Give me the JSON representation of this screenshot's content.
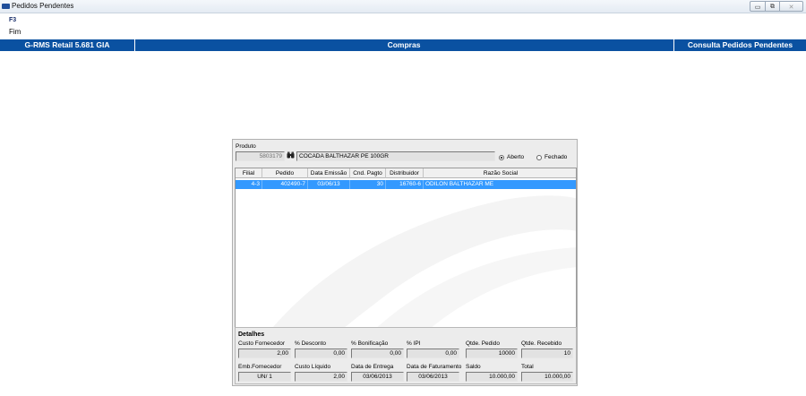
{
  "window": {
    "title": "Pedidos Pendentes",
    "buttons": [
      "▭",
      "⧉",
      "✕"
    ]
  },
  "toolbar": {
    "key": "F3",
    "label": "Fim"
  },
  "header": {
    "app": "G-RMS Retail 5.681 GIA",
    "module": "Compras",
    "screen": "Consulta Pedidos Pendentes",
    "color": "#0a51a1"
  },
  "produto": {
    "label": "Produto",
    "code": "5803179",
    "description": "COCADA BALTHAZAR                PE 100GR",
    "search_icon": "binoculars-icon",
    "radio_aberto": "Aberto",
    "radio_fechado": "Fechado",
    "selected": "Aberto"
  },
  "table": {
    "columns": [
      "Filial",
      "Pedido",
      "Data Emissão",
      "Cnd. Pagto",
      "Distribuidor",
      "Razão Social"
    ],
    "rows": [
      {
        "filial": "4-3",
        "pedido": "402490-7",
        "data_emissao": "03/06/13",
        "cnd_pagto": "30",
        "distribuidor": "16760-6",
        "razao_social": "ODILON BALTHAZAR ME"
      }
    ],
    "selected_color": "#3399ff"
  },
  "detalhes": {
    "title": "Detalhes",
    "custo_fornecedor": {
      "label": "Custo Fornecedor",
      "value": "2,00"
    },
    "desconto": {
      "label": "% Desconto",
      "value": "0,00"
    },
    "bonificacao": {
      "label": "% Bonificação",
      "value": "0,00"
    },
    "ipi": {
      "label": "% IPI",
      "value": "0,00"
    },
    "qtde_pedido": {
      "label": "Qtde. Pedido",
      "value": "10000"
    },
    "qtde_recebido": {
      "label": "Qtde. Recebido",
      "value": "10"
    },
    "emb_fornecedor": {
      "label": "Emb.Fornecedor",
      "value": "UN/ 1"
    },
    "custo_liquido": {
      "label": "Custo Líquido",
      "value": "2,00"
    },
    "data_entrega": {
      "label": "Data de Entrega",
      "value": "03/06/2013"
    },
    "data_faturamento": {
      "label": "Data de Faturamento",
      "value": "03/06/2013"
    },
    "saldo": {
      "label": "Saldo",
      "value": "10.000,00"
    },
    "total": {
      "label": "Total",
      "value": "10.000,00"
    }
  }
}
